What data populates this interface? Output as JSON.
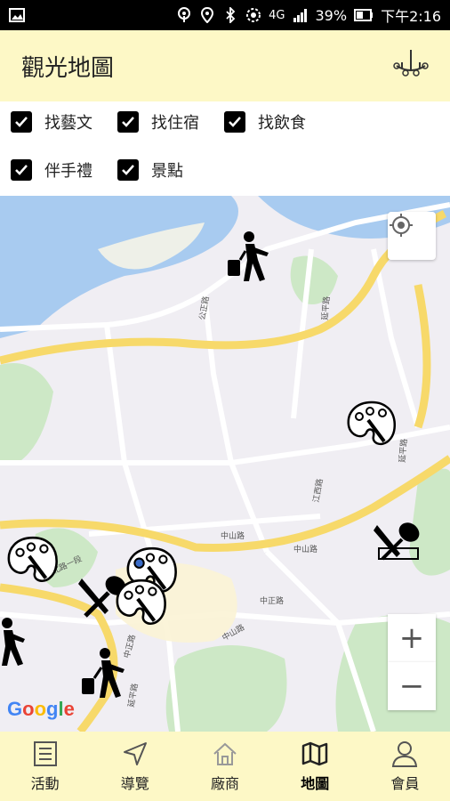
{
  "statusbar": {
    "battery": "39%",
    "time": "下午2:16",
    "network": "4G"
  },
  "appbar": {
    "title": "觀光地圖",
    "icon": "chandelier-icon"
  },
  "filters": [
    {
      "label": "找藝文",
      "checked": true
    },
    {
      "label": "找住宿",
      "checked": true
    },
    {
      "label": "找飲食",
      "checked": true
    },
    {
      "label": "伴手禮",
      "checked": true
    },
    {
      "label": "景點",
      "checked": true
    }
  ],
  "map": {
    "attribution": "Google",
    "zoom_in": "+",
    "zoom_out": "−",
    "road_labels": [
      "公正路",
      "延平路",
      "延平路",
      "江西路",
      "中山路",
      "中山路",
      "中正路",
      "中山路",
      "中正路",
      "北路一段",
      "延平路"
    ]
  },
  "nav": [
    {
      "label": "活動",
      "icon": "activity-list-icon"
    },
    {
      "label": "導覽",
      "icon": "navigation-arrow-icon"
    },
    {
      "label": "廠商",
      "icon": "home-icon"
    },
    {
      "label": "地圖",
      "icon": "map-icon",
      "active": true
    },
    {
      "label": "會員",
      "icon": "member-icon"
    }
  ]
}
